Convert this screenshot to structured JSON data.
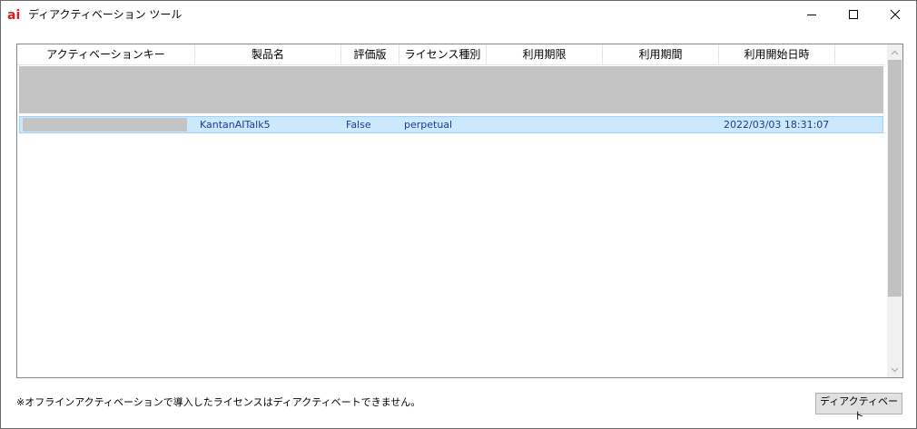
{
  "window": {
    "title": "ディアクティベーション ツール",
    "logo_text": "ai",
    "logo_color": "#d4201d",
    "controls": [
      "minimize-icon",
      "maximize-icon",
      "close-icon"
    ]
  },
  "list": {
    "columns": [
      "アクティベーションキー",
      "製品名",
      "評価版",
      "ライセンス種別",
      "利用期限",
      "利用期間",
      "利用開始日時"
    ],
    "rows": [
      {
        "key": "",
        "product": "KantanAITalk5",
        "trial": "False",
        "license_type": "perpetual",
        "expiry": "",
        "period": "",
        "start": "2022/03/03 18:31:07"
      }
    ],
    "selected_row_color": "#cce8ff"
  },
  "footer": {
    "note": "※オフラインアクティベーションで導入したライセンスはディアクティベートできません。",
    "deactivate_label": "ディアクティベート"
  }
}
